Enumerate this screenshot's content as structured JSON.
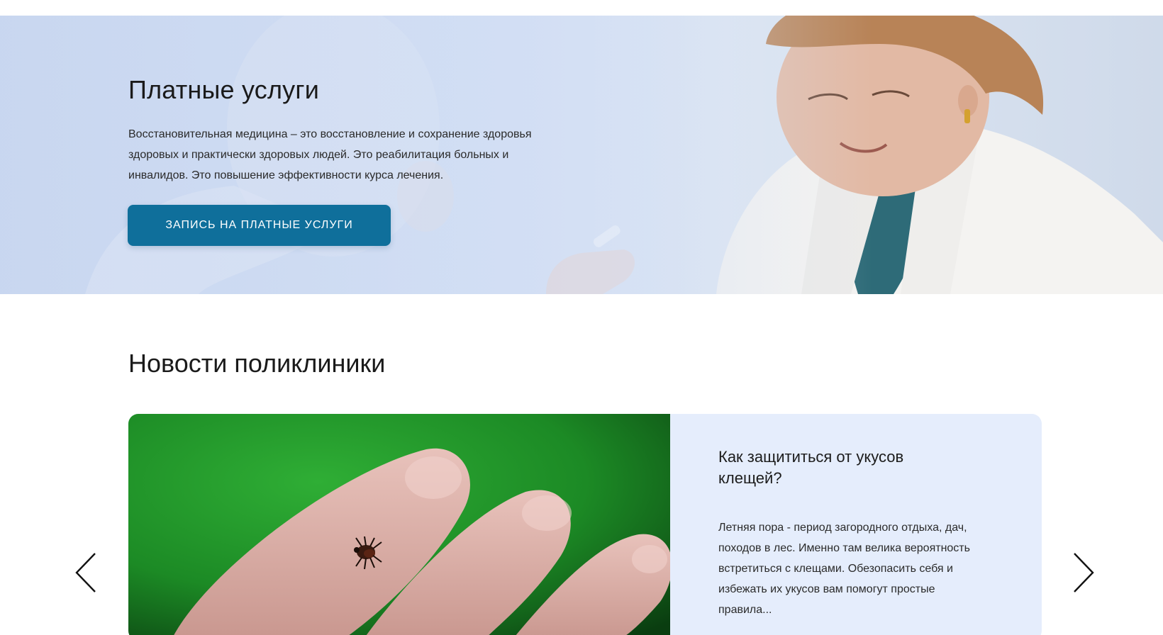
{
  "hero": {
    "title": "Платные услуги",
    "description": "Восстановительная медицина – это восстановление и сохранение здоровья здоровых и практически здоровых людей. Это реабилитация больных и инвалидов. Это повышение эффективности курса лечения.",
    "button_label": "Запись на платные услуги"
  },
  "news": {
    "section_title": "Новости поликлиники",
    "items": [
      {
        "title": "Как защититься от укусов клещей?",
        "excerpt": "Летняя пора - период загородного отдыха, дач, походов в лес. Именно там велика вероятность встретиться с клещами. Обезопасить себя и избежать их укусов вам помогут простые правила...",
        "image": "tick-on-finger-photo"
      }
    ],
    "prev_icon": "chevron-left-icon",
    "next_icon": "chevron-right-icon"
  },
  "colors": {
    "accent": "#0f6f9b",
    "hero_bg": "#d3dff4",
    "card_bg": "#e5edfc"
  }
}
